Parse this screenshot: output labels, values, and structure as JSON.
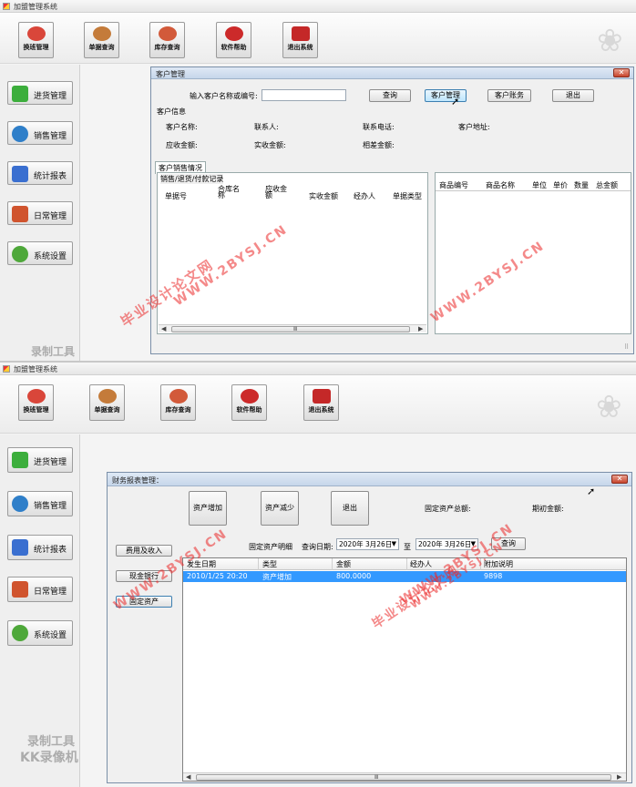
{
  "app_title": "加盟管理系统",
  "toolbar": [
    {
      "label": "换班管理",
      "icon": "people-icon",
      "color": "#d9463a"
    },
    {
      "label": "单据查询",
      "icon": "magnifier-icon",
      "color": "#c47b3a"
    },
    {
      "label": "库存查询",
      "icon": "coins-icon",
      "color": "#d25a3a"
    },
    {
      "label": "软件帮助",
      "icon": "help-icon",
      "color": "#cc2a2a"
    },
    {
      "label": "退出系统",
      "icon": "power-icon",
      "color": "#c42828"
    }
  ],
  "sidebar": [
    {
      "label": "进货管理",
      "icon": "plus-icon",
      "color": "#3cae3c"
    },
    {
      "label": "销售管理",
      "icon": "globe-icon",
      "color": "#2f7fc9"
    },
    {
      "label": "统计报表",
      "icon": "bar-chart-icon",
      "color": "#3a6fd0"
    },
    {
      "label": "日常管理",
      "icon": "brush-icon",
      "color": "#d0542e"
    },
    {
      "label": "系统设置",
      "icon": "gear-icon",
      "color": "#4ea83a"
    }
  ],
  "customer": {
    "title": "客户管理",
    "search_label": "输入客户名称或编号:",
    "search_value": "",
    "buttons": [
      "查询",
      "客户管理",
      "客户账务",
      "退出"
    ],
    "info_group": "客户信息",
    "fields_row1": [
      "客户名称:",
      "联系人:",
      "联系电话:",
      "客户地址:"
    ],
    "fields_row2": [
      "应收金额:",
      "实收金额:",
      "相差金额:"
    ],
    "tab": "客户销售情况",
    "records_group": "销售/退货/付款记录",
    "left_columns": [
      "单据号",
      "合库名称",
      "应收金额",
      "实收金额",
      "经办人",
      "单据类型"
    ],
    "right_columns": [
      "商品编号",
      "商品名称",
      "单位",
      "单价",
      "数量",
      "总金额"
    ],
    "scroll_thumb": "Ⅲ"
  },
  "finance": {
    "title": "财务报表管理：",
    "buttons": [
      "资产增加",
      "资产减少",
      "退出"
    ],
    "total_label": "固定资产总额:",
    "initial_label": "期初金额:",
    "side_buttons": [
      "费用及收入",
      "现金银行",
      "固定资产"
    ],
    "detail_label": "固定资产明细",
    "date_label": "查询日期:",
    "date_from": "2020年 3月26日",
    "to_label": "至",
    "date_to": "2020年 3月26日",
    "query_button": "查询",
    "columns": [
      "发生日期",
      "类型",
      "金额",
      "经办人",
      "附加说明"
    ],
    "rows": [
      [
        "2010/1/25 20:20",
        "资产增加",
        "800.0000",
        "",
        "9898"
      ]
    ],
    "scroll_thumb": "Ⅲ"
  },
  "watermarks": {
    "url": "WWW.2BYSJ.CN",
    "site": "毕业设计论文网",
    "tool": "录制工具",
    "tool2": "KK录像机"
  }
}
